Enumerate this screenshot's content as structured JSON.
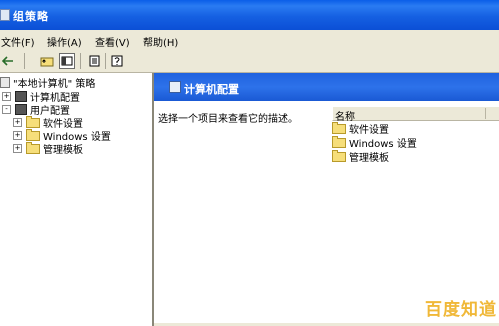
{
  "window": {
    "title": "组策略"
  },
  "menu": [
    {
      "label": "文件(F)"
    },
    {
      "label": "操作(A)"
    },
    {
      "label": "查看(V)"
    },
    {
      "label": "帮助(H)"
    }
  ],
  "toolbar": {
    "buttons": [
      {
        "icon": "back-arrow-icon"
      },
      {
        "icon": "up-folder-icon"
      },
      {
        "icon": "show-hide-tree-icon"
      },
      {
        "icon": "export-list-icon"
      },
      {
        "icon": "help-icon"
      }
    ]
  },
  "tree": {
    "root": "\"本地计算机\" 策略",
    "items": [
      {
        "label": "计算机配置",
        "expander": "+"
      },
      {
        "label": "用户配置",
        "expander": "-"
      },
      {
        "label": "软件设置",
        "expander": "+"
      },
      {
        "label": "Windows 设置",
        "expander": "+"
      },
      {
        "label": "管理模板",
        "expander": "+"
      }
    ]
  },
  "right": {
    "title": "计算机配置",
    "description": "选择一个项目来查看它的描述。",
    "column_name": "名称",
    "items": [
      {
        "label": "软件设置"
      },
      {
        "label": "Windows 设置"
      },
      {
        "label": "管理模板"
      }
    ]
  },
  "watermark": "百度知道"
}
